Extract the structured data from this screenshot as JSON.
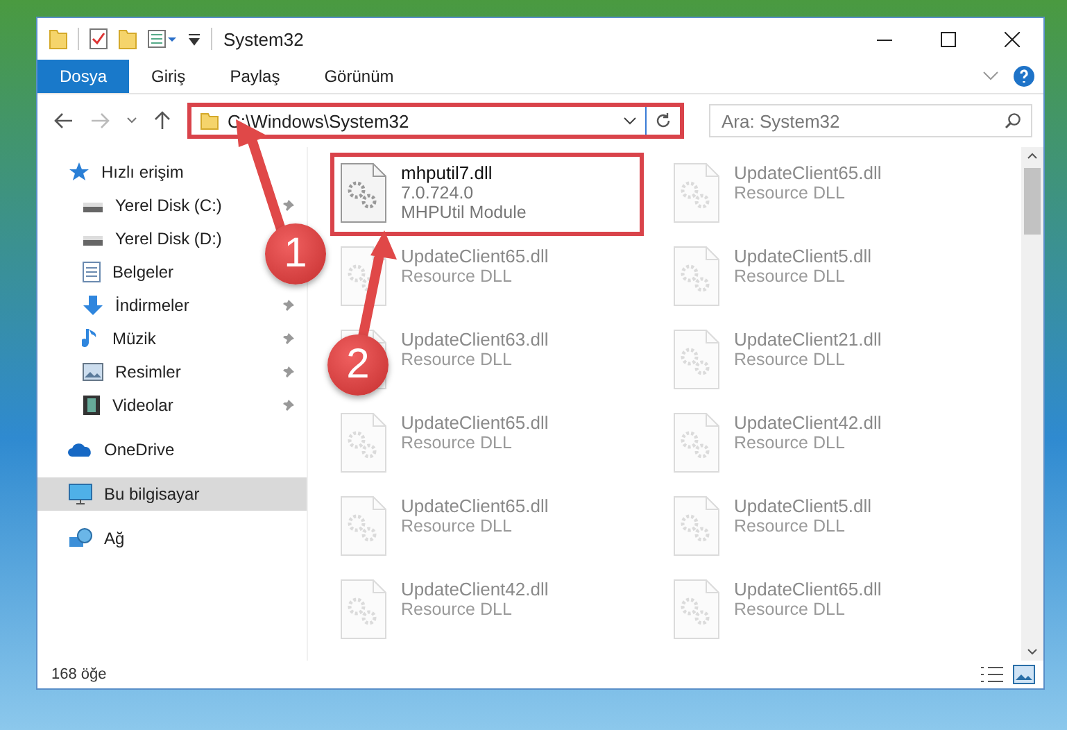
{
  "window": {
    "title": "System32"
  },
  "ribbon": {
    "tabs": [
      {
        "label": "Dosya",
        "selected": true
      },
      {
        "label": "Giriş",
        "selected": false
      },
      {
        "label": "Paylaş",
        "selected": false
      },
      {
        "label": "Görünüm",
        "selected": false
      }
    ]
  },
  "address_bar": {
    "path": "C:\\Windows\\System32",
    "highlighted": true
  },
  "search": {
    "placeholder": "Ara: System32"
  },
  "sidebar": {
    "items": [
      {
        "label": "Hızlı erişim",
        "kind": "star",
        "selected": false,
        "children": [
          {
            "label": "Yerel Disk (C:)",
            "kind": "drive",
            "pinned": true,
            "selected": false
          },
          {
            "label": "Yerel Disk (D:)",
            "kind": "drive",
            "selected": false
          },
          {
            "label": "Belgeler",
            "kind": "document",
            "selected": false
          },
          {
            "label": "İndirmeler",
            "kind": "download",
            "pinned": true,
            "selected": false
          },
          {
            "label": "Müzik",
            "kind": "music",
            "pinned": true,
            "selected": false
          },
          {
            "label": "Resimler",
            "kind": "pictures",
            "pinned": true,
            "selected": false
          },
          {
            "label": "Videolar",
            "kind": "video",
            "pinned": true,
            "selected": false
          }
        ]
      },
      {
        "label": "OneDrive",
        "kind": "cloud",
        "selected": false
      },
      {
        "label": "Bu bilgisayar",
        "kind": "computer",
        "selected": true
      },
      {
        "label": "Ağ",
        "kind": "network",
        "selected": false
      }
    ]
  },
  "files": [
    {
      "name": "mhputil7.dll",
      "lines": [
        "7.0.724.0",
        "MHPUtil Module"
      ],
      "faded": false,
      "highlighted": true
    },
    {
      "name": "UpdateClient65.dll",
      "lines": [
        "Resource DLL"
      ],
      "faded": true,
      "highlighted": false
    },
    {
      "name": "UpdateClient65.dll",
      "lines": [
        "Resource DLL"
      ],
      "faded": true,
      "highlighted": false
    },
    {
      "name": "UpdateClient5.dll",
      "lines": [
        "Resource DLL"
      ],
      "faded": true,
      "highlighted": false
    },
    {
      "name": "UpdateClient63.dll",
      "lines": [
        "Resource DLL"
      ],
      "faded": true,
      "highlighted": false
    },
    {
      "name": "UpdateClient21.dll",
      "lines": [
        "Resource DLL"
      ],
      "faded": true,
      "highlighted": false
    },
    {
      "name": "UpdateClient65.dll",
      "lines": [
        "Resource DLL"
      ],
      "faded": true,
      "highlighted": false
    },
    {
      "name": "UpdateClient42.dll",
      "lines": [
        "Resource DLL"
      ],
      "faded": true,
      "highlighted": false
    },
    {
      "name": "UpdateClient65.dll",
      "lines": [
        "Resource DLL"
      ],
      "faded": true,
      "highlighted": false
    },
    {
      "name": "UpdateClient5.dll",
      "lines": [
        "Resource DLL"
      ],
      "faded": true,
      "highlighted": false
    },
    {
      "name": "UpdateClient42.dll",
      "lines": [
        "Resource DLL"
      ],
      "faded": true,
      "highlighted": false
    },
    {
      "name": "UpdateClient65.dll",
      "lines": [
        "Resource DLL"
      ],
      "faded": true,
      "highlighted": false
    }
  ],
  "status_bar": {
    "count": "168 öğe"
  },
  "annotations": [
    {
      "label": "1"
    },
    {
      "label": "2"
    }
  ]
}
